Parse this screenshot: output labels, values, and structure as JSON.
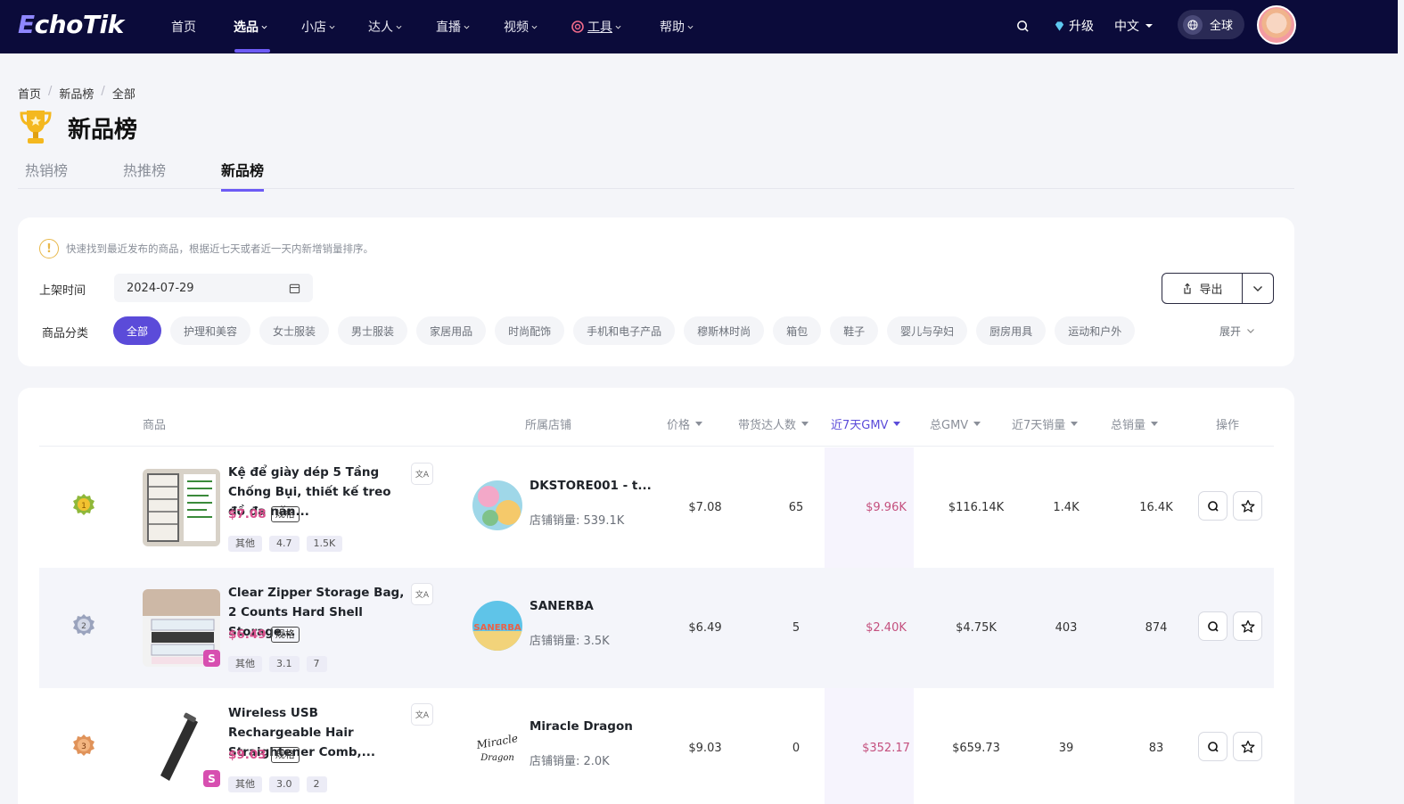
{
  "nav": {
    "logo_e": "E",
    "logo_rest": "choTik",
    "items": [
      "首页",
      "选品",
      "小店",
      "达人",
      "直播",
      "视频",
      "工具",
      "帮助"
    ],
    "upgrade": "升级",
    "language": "中文",
    "region": "全球"
  },
  "breadcrumb": [
    "首页",
    "新品榜",
    "全部"
  ],
  "page_title": "新品榜",
  "tabs": [
    "热销榜",
    "热推榜",
    "新品榜"
  ],
  "filter": {
    "tip": "快速找到最近发布的商品，根据近七天或者近一天内新增销量排序。",
    "date_label": "上架时间",
    "date_value": "2024-07-29",
    "export_label": "导出",
    "category_label": "商品分类",
    "categories": [
      "全部",
      "护理和美容",
      "女士服装",
      "男士服装",
      "家居用品",
      "时尚配饰",
      "手机和电子产品",
      "穆斯林时尚",
      "箱包",
      "鞋子",
      "婴儿与孕妇",
      "厨房用具",
      "运动和户外"
    ],
    "expand_label": "展开"
  },
  "table": {
    "headers": {
      "product": "商品",
      "shop": "所属店铺",
      "price": "价格",
      "creators": "带货达人数",
      "gmv7": "近7天GMV",
      "gmv_total": "总GMV",
      "sales7": "近7天销量",
      "sales_total": "总销量",
      "actions": "操作"
    },
    "spec_label": "规格",
    "shop_sales_prefix": "店铺销量: ",
    "rows": [
      {
        "name": "Kệ để giày dép 5 Tầng Chống Bụi, thiết kế treo đồ đa năn...",
        "price": "$7.08",
        "tags": [
          "其他",
          "4.7",
          "1.5K"
        ],
        "shop_name": "DKSTORE001 - t...",
        "shop_sales": "店铺销量: 539.1K",
        "price_col": "$7.08",
        "creators": "65",
        "gmv7": "$9.96K",
        "gmv_total": "$116.14K",
        "sales7": "1.4K",
        "sales_total": "16.4K"
      },
      {
        "name": "Clear Zipper Storage Bag, 2 Counts Hard Shell Storage...",
        "price": "$6.49",
        "tags": [
          "其他",
          "3.1",
          "7"
        ],
        "shop_name": "SANERBA",
        "shop_logo_text": "SANERBA",
        "shop_sales": "店铺销量: 3.5K",
        "price_col": "$6.49",
        "creators": "5",
        "gmv7": "$2.40K",
        "gmv_total": "$4.75K",
        "sales7": "403",
        "sales_total": "874"
      },
      {
        "name": "Wireless USB Rechargeable Hair Straightener Comb,...",
        "price": "$9.03",
        "tags": [
          "其他",
          "3.0",
          "2"
        ],
        "shop_name": "Miracle Dragon",
        "shop_logo_text_1": "Miracle",
        "shop_logo_text_2": "Dragon",
        "shop_sales": "店铺销量: 2.0K",
        "price_col": "$9.03",
        "creators": "0",
        "gmv7": "$352.17",
        "gmv_total": "$659.73",
        "sales7": "39",
        "sales_total": "83"
      }
    ],
    "shop_badge": "S"
  },
  "colors": {
    "nav_bg": "#0b0b3a",
    "accent": "#5b4bd9",
    "price": "#d74f8c"
  }
}
